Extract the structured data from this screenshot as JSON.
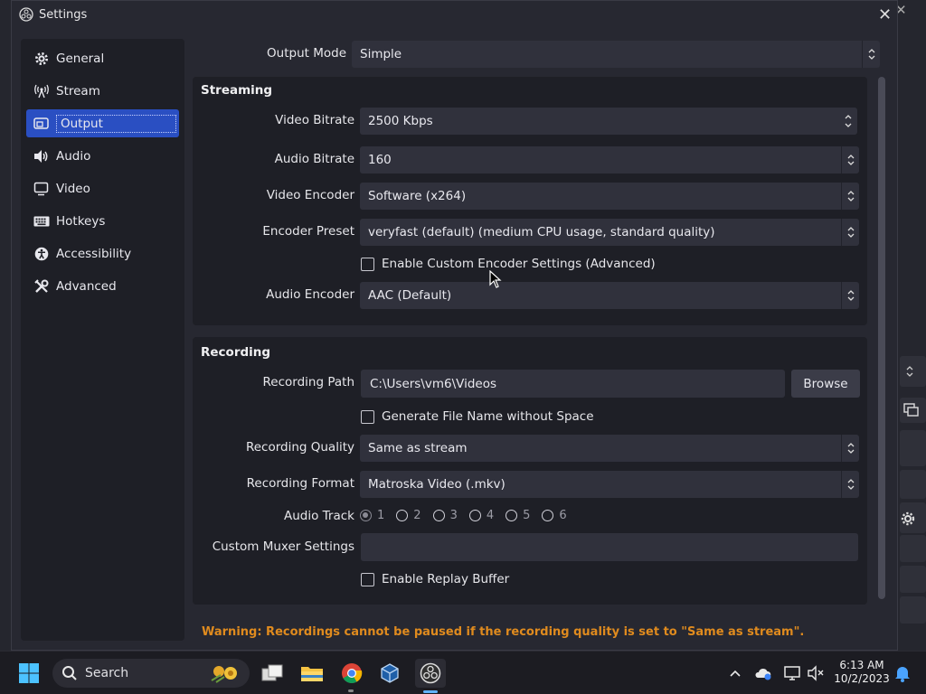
{
  "window": {
    "title": "Settings"
  },
  "sidebar": {
    "items": [
      {
        "label": "General",
        "icon": "gear-icon"
      },
      {
        "label": "Stream",
        "icon": "antenna-icon"
      },
      {
        "label": "Output",
        "icon": "output-icon",
        "active": true
      },
      {
        "label": "Audio",
        "icon": "speaker-icon"
      },
      {
        "label": "Video",
        "icon": "monitor-icon"
      },
      {
        "label": "Hotkeys",
        "icon": "keyboard-icon"
      },
      {
        "label": "Accessibility",
        "icon": "accessibility-icon"
      },
      {
        "label": "Advanced",
        "icon": "tools-icon"
      }
    ]
  },
  "output_mode": {
    "label": "Output Mode",
    "value": "Simple"
  },
  "streaming": {
    "title": "Streaming",
    "video_bitrate": {
      "label": "Video Bitrate",
      "value": "2500 Kbps"
    },
    "audio_bitrate": {
      "label": "Audio Bitrate",
      "value": "160"
    },
    "video_encoder": {
      "label": "Video Encoder",
      "value": "Software (x264)"
    },
    "encoder_preset": {
      "label": "Encoder Preset",
      "value": "veryfast (default) (medium CPU usage, standard quality)"
    },
    "custom_encoder": {
      "label": "Enable Custom Encoder Settings (Advanced)",
      "checked": false
    },
    "audio_encoder": {
      "label": "Audio Encoder",
      "value": "AAC (Default)"
    }
  },
  "recording": {
    "title": "Recording",
    "path": {
      "label": "Recording Path",
      "value": "C:\\Users\\vm6\\Videos",
      "browse": "Browse"
    },
    "no_space": {
      "label": "Generate File Name without Space",
      "checked": false
    },
    "quality": {
      "label": "Recording Quality",
      "value": "Same as stream"
    },
    "format": {
      "label": "Recording Format",
      "value": "Matroska Video (.mkv)"
    },
    "audio_track": {
      "label": "Audio Track",
      "tracks": [
        "1",
        "2",
        "3",
        "4",
        "5",
        "6"
      ],
      "selected": "1"
    },
    "muxer": {
      "label": "Custom Muxer Settings",
      "value": ""
    },
    "replay_buffer": {
      "label": "Enable Replay Buffer",
      "checked": false
    }
  },
  "warning": "Warning: Recordings cannot be paused if the recording quality is set to \"Same as stream\".",
  "taskbar": {
    "search_label": "Search",
    "time": "6:13 AM",
    "date": "10/2/2023"
  },
  "colors": {
    "accent": "#2a4fc2",
    "warning": "#e08b1e"
  }
}
